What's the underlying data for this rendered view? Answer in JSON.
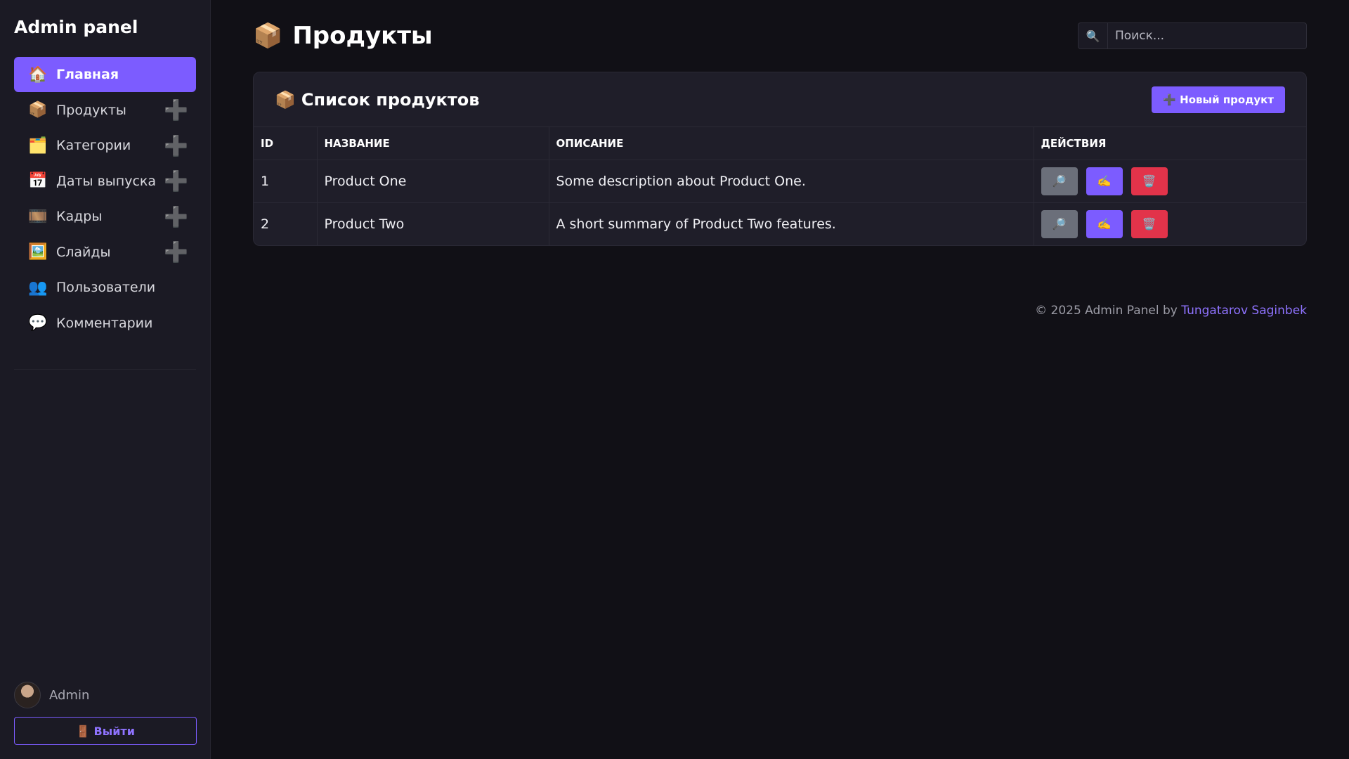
{
  "sidebar": {
    "brand": "Admin panel",
    "items": [
      {
        "label": "Главная",
        "icon": "🏠",
        "has_add": false
      },
      {
        "label": "Продукты",
        "icon": "📦",
        "has_add": true
      },
      {
        "label": "Категории",
        "icon": "🗂️",
        "has_add": true
      },
      {
        "label": "Даты выпуска",
        "icon": "📅",
        "has_add": true
      },
      {
        "label": "Кадры",
        "icon": "🎞️",
        "has_add": true
      },
      {
        "label": "Слайды",
        "icon": "🖼️",
        "has_add": true
      },
      {
        "label": "Пользователи",
        "icon": "👥",
        "has_add": false
      },
      {
        "label": "Комментарии",
        "icon": "💬",
        "has_add": false
      }
    ],
    "add_glyph": "➕",
    "user": {
      "name": "Admin"
    },
    "logout_label": "🚪 Выйти"
  },
  "header": {
    "title_icon": "📦",
    "title": "Продукты",
    "search_icon": "🔍",
    "search_placeholder": "Поиск..."
  },
  "card": {
    "title_icon": "📦",
    "title": "Список продуктов",
    "new_button_label": "➕ Новый продукт"
  },
  "table": {
    "columns": [
      "ID",
      "НАЗВАНИЕ",
      "ОПИСАНИЕ",
      "ДЕЙСТВИЯ"
    ],
    "rows": [
      {
        "id": "1",
        "name": "Product One",
        "description": "Some description about Product One."
      },
      {
        "id": "2",
        "name": "Product Two",
        "description": "A short summary of Product Two features."
      }
    ],
    "action_icons": {
      "view": "🔎",
      "edit": "✍️",
      "delete": "🗑️"
    }
  },
  "footer": {
    "text": "© 2025 Admin Panel by ",
    "author": "Tungatarov Saginbek"
  },
  "colors": {
    "accent": "#7c5cff",
    "danger": "#e2334a",
    "neutral_button": "#6b6f7a",
    "background": "#111016",
    "sidebar": "#1b1a24",
    "card": "#1f1e29"
  }
}
